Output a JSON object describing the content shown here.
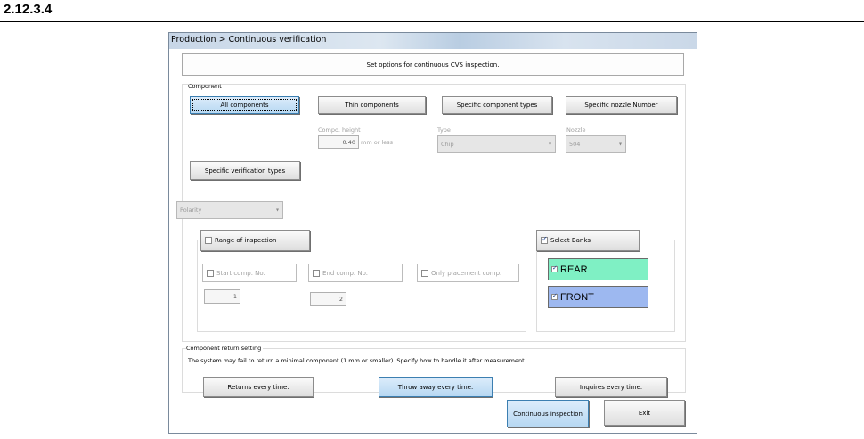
{
  "section_number": "2.12.3.4",
  "window": {
    "title": "Production > Continuous verification"
  },
  "header_message": "Set options for continuous CVS inspection.",
  "component": {
    "group_label": "Component",
    "buttons": {
      "all": "All components",
      "thin": "Thin components",
      "specific_types": "Specific component types",
      "specific_nozzle": "Specific nozzle Number",
      "specific_verification": "Specific verification types"
    },
    "compo_height": {
      "label": "Compo. height",
      "value": "0.40",
      "unit": "mm or less"
    },
    "type": {
      "label": "Type",
      "value": "Chip",
      "arrow": "▾"
    },
    "nozzle": {
      "label": "Nozzle",
      "value": "504",
      "arrow": "▾"
    },
    "verification_select": {
      "value": "Polarity",
      "arrow": "▾"
    }
  },
  "range": {
    "label": "Range of inspection",
    "start_comp": "Start comp. No.",
    "end_comp": "End comp. No.",
    "only_placement": "Only placement comp.",
    "start_value": "1",
    "end_value": "2"
  },
  "banks": {
    "label": "Select Banks",
    "rear": "REAR",
    "front": "FRONT",
    "rear_color": "#7ff0c4",
    "front_color": "#9db8f0"
  },
  "return_setting": {
    "label": "Component return setting",
    "description": "The system may fail to return a minimal component (1 mm or smaller). Specify how to handle it after measurement.",
    "returns_every_time": "Returns every time.",
    "throw_away": "Throw away every time.",
    "inquires": "Inquires every time."
  },
  "footer": {
    "continuous_inspection": "Continuous inspection",
    "exit": "Exit"
  }
}
